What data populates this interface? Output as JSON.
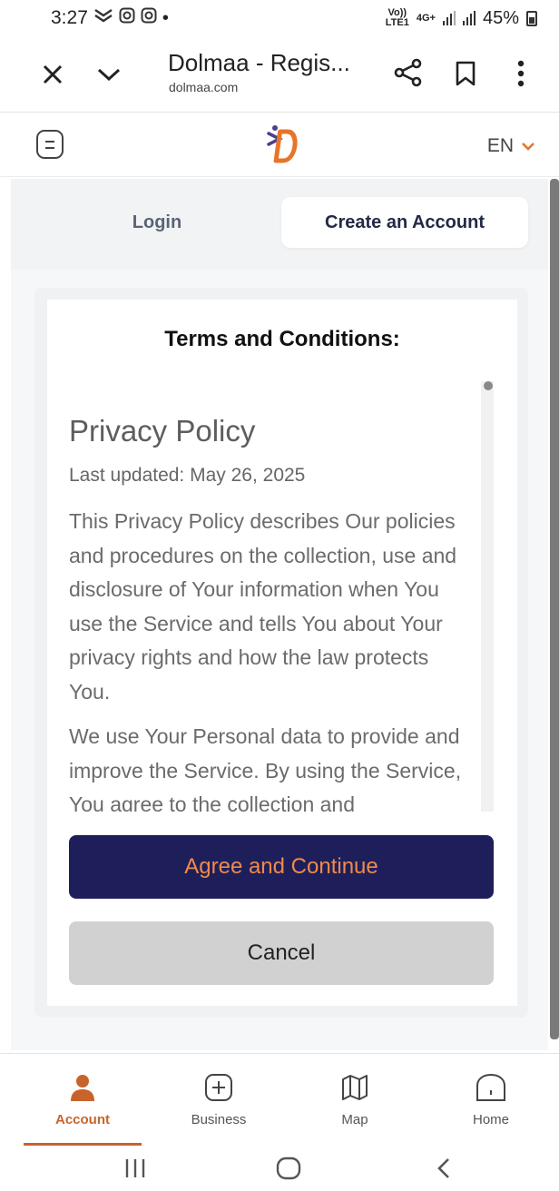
{
  "status_bar": {
    "time": "3:27",
    "network_label_top": "Vo))",
    "network_label_bottom": "LTE1",
    "network_type": "4G+",
    "battery": "45%"
  },
  "browser": {
    "title": "Dolmaa - Regis...",
    "url": "dolmaa.com"
  },
  "header": {
    "language": "EN"
  },
  "tabs": {
    "login": "Login",
    "create_account": "Create an Account"
  },
  "terms": {
    "heading": "Terms and Conditions:",
    "policy_title": "Privacy Policy",
    "last_updated": "Last updated: May 26, 2025",
    "paragraphs": [
      "This Privacy Policy describes Our policies and procedures on the collection, use and disclosure of Your information when You use the Service and tells You about Your privacy rights and how the law protects You.",
      "We use Your Personal data to provide and improve the Service. By using the Service, You agree to the collection and"
    ]
  },
  "buttons": {
    "agree": "Agree and Continue",
    "cancel": "Cancel"
  },
  "bottom_nav": {
    "items": [
      {
        "label": "Account",
        "icon": "person-icon",
        "active": true
      },
      {
        "label": "Business",
        "icon": "plus-square-icon",
        "active": false
      },
      {
        "label": "Map",
        "icon": "map-icon",
        "active": false
      },
      {
        "label": "Home",
        "icon": "home-icon",
        "active": false
      }
    ]
  },
  "colors": {
    "accent": "#c7642b",
    "agree_bg": "#1e1f5a",
    "agree_text": "#f08a4b",
    "cancel_bg": "#d1d1d1"
  }
}
